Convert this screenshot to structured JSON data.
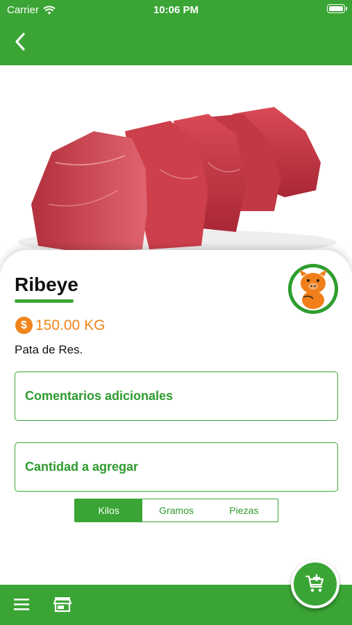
{
  "status_bar": {
    "carrier": "Carrier",
    "time": "10:06 PM"
  },
  "app_bar": {
    "back_icon": "chevron-left-icon"
  },
  "product": {
    "name": "Ribeye",
    "price": "150.00 KG",
    "currency_icon": "dollar-coin-icon",
    "category": "Pata de Res.",
    "image": "raw-beef-cuts-image",
    "vendor_logo": "pig-mascot-logo"
  },
  "form": {
    "comments_placeholder": "Comentarios adicionales",
    "quantity_placeholder": "Cantidad a agregar"
  },
  "units": {
    "options": [
      "Kilos",
      "Gramos",
      "Piezas"
    ],
    "selected": "Kilos"
  },
  "bottom_bar": {
    "menu_icon": "hamburger-menu-icon",
    "store_icon": "store-icon",
    "fab_icon": "add-to-cart-icon"
  },
  "colors": {
    "primary_green": "#3aa534",
    "accent_orange": "#f0851b"
  }
}
